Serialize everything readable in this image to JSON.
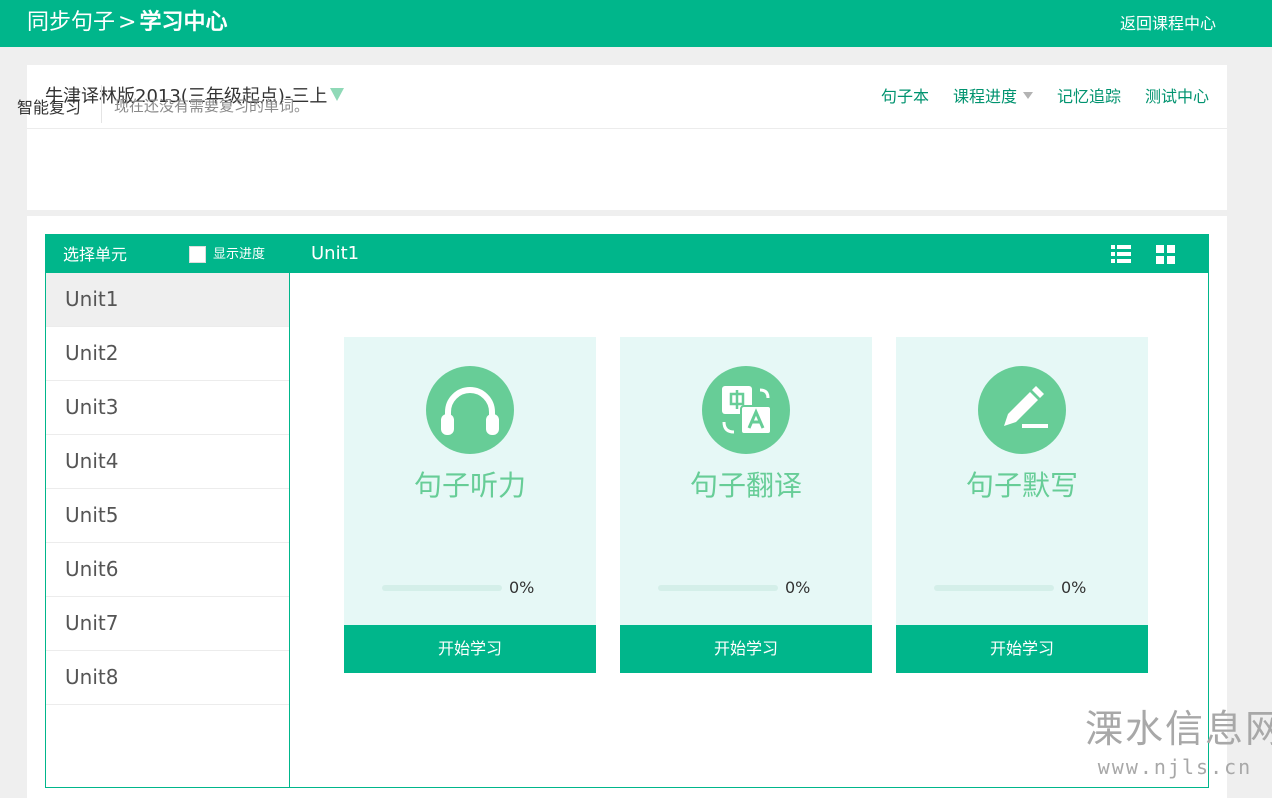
{
  "header": {
    "crumb_parent": "同步句子",
    "crumb_separator": ">",
    "crumb_current": "学习中心",
    "back_link": "返回课程中心",
    "accent_color": "#00b68b"
  },
  "course": {
    "title": "牛津译林版2013(三年级起点)-三上",
    "nav": [
      "句子本",
      "课程进度",
      "记忆追踪",
      "测试中心"
    ]
  },
  "review": {
    "label": "智能复习",
    "message": "现在还没有需要复习的单词。"
  },
  "sidebar": {
    "title": "选择单元",
    "show_progress_label": "显示进度",
    "show_progress_checked": false,
    "units": [
      "Unit1",
      "Unit2",
      "Unit3",
      "Unit4",
      "Unit5",
      "Unit6",
      "Unit7",
      "Unit8"
    ],
    "active_unit": "Unit1"
  },
  "content": {
    "title": "Unit1",
    "view_icons": [
      "list-view-icon",
      "grid-view-icon"
    ],
    "cards": [
      {
        "icon": "headphones-icon",
        "name": "句子听力",
        "progress": 0,
        "progress_label": "0%",
        "button": "开始学习"
      },
      {
        "icon": "translate-icon",
        "name": "句子翻译",
        "progress": 0,
        "progress_label": "0%",
        "button": "开始学习"
      },
      {
        "icon": "pencil-icon",
        "name": "句子默写",
        "progress": 0,
        "progress_label": "0%",
        "button": "开始学习"
      }
    ]
  },
  "watermark": {
    "name": "溧水信息网",
    "url": "www.njls.cn"
  }
}
